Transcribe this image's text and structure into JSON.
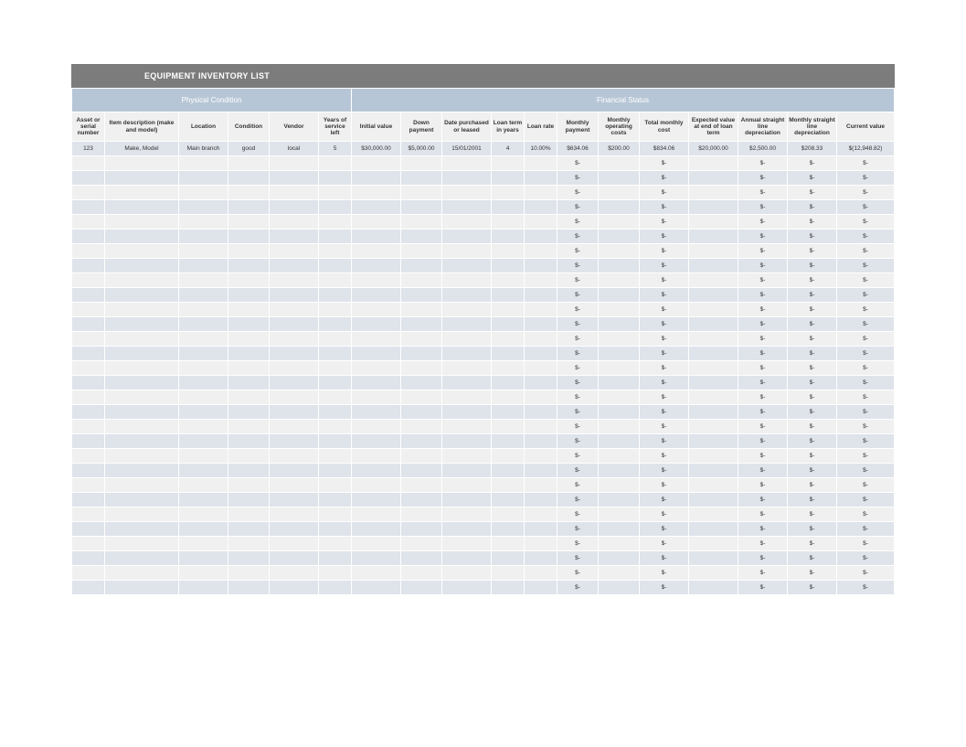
{
  "title": "EQUIPMENT INVENTORY LIST",
  "groupHeaders": {
    "physical": "Physical Condition",
    "financial": "Financial Status"
  },
  "columns": {
    "asset": "Asset or serial number",
    "desc": "Item description (make and model)",
    "loc": "Location",
    "cond": "Condition",
    "vendor": "Vendor",
    "years": "Years of service left",
    "initval": "Initial value",
    "down": "Down payment",
    "date": "Date purchased or leased",
    "term": "Loan term in years",
    "rate": "Loan rate",
    "mpay": "Monthly payment",
    "opcost": "Monthly operating costs",
    "total": "Total monthly cost",
    "expval": "Expected value at end of loan term",
    "anndep": "Annual straight line depreciation",
    "mondep": "Monthly straight line depreciation",
    "curval": "Current value"
  },
  "dataRow": {
    "asset": "123",
    "desc": "Make, Model",
    "loc": "Main branch",
    "cond": "good",
    "vendor": "local",
    "years": "5",
    "initval": "$30,000.00",
    "down": "$5,000.00",
    "date": "15/01/2001",
    "term": "4",
    "rate": "10.00%",
    "mpay": "$634.06",
    "opcost": "$200.00",
    "total": "$834.06",
    "expval": "$20,000.00",
    "anndep": "$2,500.00",
    "mondep": "$208.33",
    "curval": "$(12,948.82)"
  },
  "emptyPlaceholder": "$-",
  "emptyRowCount": 30
}
